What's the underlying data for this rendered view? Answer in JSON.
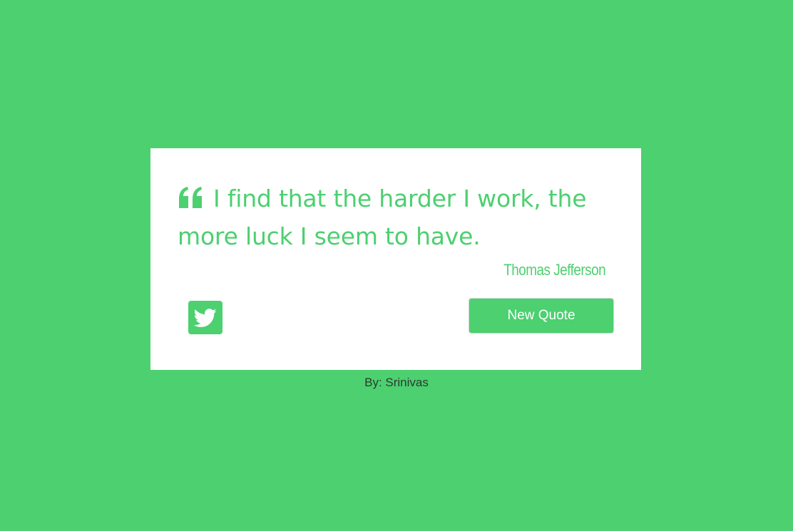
{
  "quote": {
    "text": "I find that the harder I work, the more luck I seem to have.",
    "author": "Thomas Jefferson",
    "icon": "quote-left-icon"
  },
  "actions": {
    "tweet_icon": "twitter-icon",
    "new_quote_label": "New Quote"
  },
  "footer": {
    "credit": "By: Srinivas"
  },
  "colors": {
    "accent": "#4cd070",
    "card_bg": "#ffffff",
    "footer_text": "#2a3a2f"
  }
}
